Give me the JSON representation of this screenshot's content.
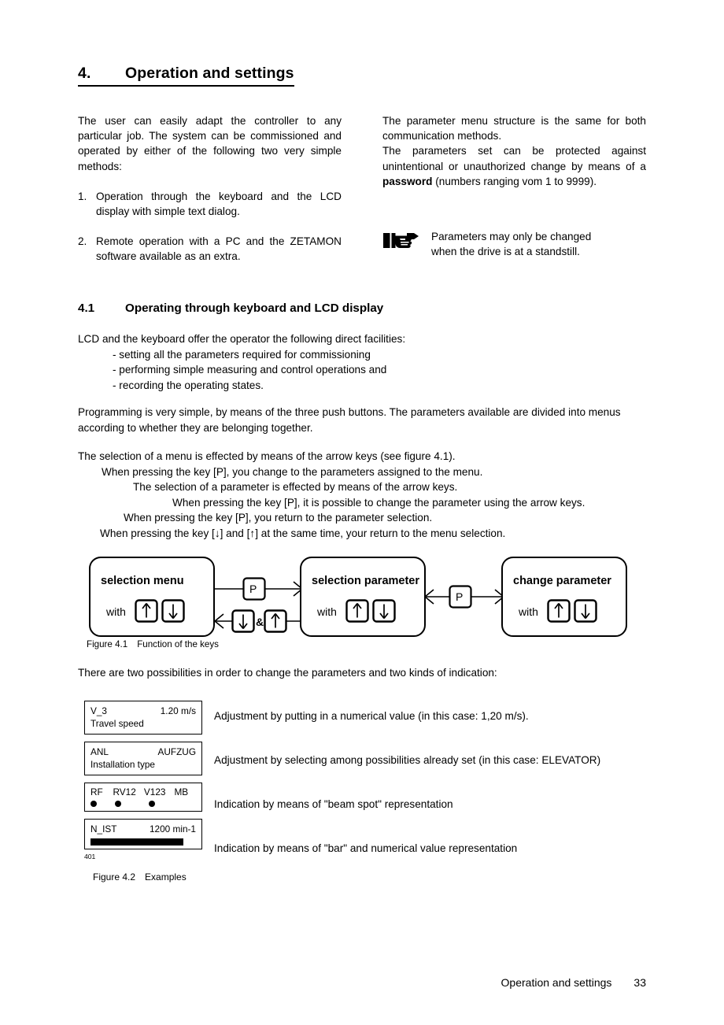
{
  "heading": {
    "number": "4.",
    "title": "Operation and settings"
  },
  "intro": {
    "left": {
      "paragraph": "The user can easily adapt the controller to any particular job. The system can be commissioned and operated by either of the following two very simple methods:",
      "items": [
        {
          "marker": "1.",
          "text": "Operation through the keyboard and the LCD display with simple text dialog."
        },
        {
          "marker": "2.",
          "text": "Remote operation with a PC and the ZETAMON software available as an extra."
        }
      ]
    },
    "right": {
      "paragraph_1": "The parameter menu structure is the same for both communication methods.",
      "paragraph_2_pre": "The parameters set can be protected against unintentional or unauthorized change by means of a ",
      "paragraph_2_bold": "password",
      "paragraph_2_post": " (numbers ranging vom 1 to 9999).",
      "note": {
        "icon": "pointing-hand-icon",
        "line_1": "Parameters may only be changed",
        "line_2": "when the drive is at a standstill."
      }
    }
  },
  "section41": {
    "number": "4.1",
    "title": "Operating through keyboard and LCD display",
    "facilities_intro": "LCD and the keyboard offer the operator the following direct facilities:",
    "facilities": [
      "- setting all the parameters required for commissioning",
      "- performing simple measuring and control operations and",
      "- recording the operating states."
    ],
    "programming": "Programming is very simple, by means of the three push buttons. The parameters available are divided into menus according to whether they are belonging together.",
    "stairs": [
      "The selection of a menu is effected by means of the arrow keys (see figure 4.1).",
      "When pressing the key [P], you change to the parameters assigned to the menu.",
      "The selection of a parameter is effected by means of the arrow keys.",
      "When pressing the key [P], it is possible to change the parameter using the arrow keys.",
      "When pressing the key [P], you return to the parameter selection.",
      "When pressing the key [↓] and [↑] at the same time, your return to the menu selection."
    ],
    "possibilities": "There are two possibilities in order to change the parameters and two kinds of indication:"
  },
  "figure41": {
    "caption_number": "Figure 4.1",
    "caption_text": "Function of the keys",
    "boxes": [
      {
        "title": "selection menu",
        "with_label": "with",
        "keys": [
          "up-arrow-key",
          "down-arrow-key"
        ]
      },
      {
        "title": "selection parameter",
        "with_label": "with",
        "keys": [
          "up-arrow-key",
          "down-arrow-key"
        ]
      },
      {
        "title": "change parameter",
        "with_label": "with",
        "keys": [
          "up-arrow-key",
          "down-arrow-key"
        ]
      }
    ],
    "connectors": {
      "top_key_1": "P",
      "bottom_key_down": "↓",
      "bottom_amp": "&",
      "bottom_key_up": "↑",
      "mid_key_2": "P"
    }
  },
  "figure42": {
    "caption_number": "Figure 4.2",
    "caption_text": "Examples",
    "drawing_id": "401",
    "examples": [
      {
        "type": "numeric",
        "line1_left": "V_3",
        "line1_right": "1.20 m/s",
        "line2": "Travel speed",
        "description": "Adjustment by putting in a numerical value (in this case: 1,20 m/s)."
      },
      {
        "type": "selection",
        "line1_left": "ANL",
        "line1_right": "AUFZUG",
        "line2": "Installation type",
        "description": "Adjustment by selecting among possibilities already set (in this case: ELEVATOR)"
      },
      {
        "type": "beam-spot",
        "labels": [
          "RF",
          "RV12",
          "V123",
          "MB"
        ],
        "dots": [
          true,
          true,
          true,
          false
        ],
        "description": "Indication by means of \"beam spot\" representation"
      },
      {
        "type": "bar",
        "line1_left": "N_IST",
        "line1_right": "1200 min-1",
        "bar_fill_percent": 88,
        "description": "Indication by means of \"bar\" and numerical value representation"
      }
    ]
  },
  "footer": {
    "title": "Operation and settings",
    "page": "33"
  }
}
